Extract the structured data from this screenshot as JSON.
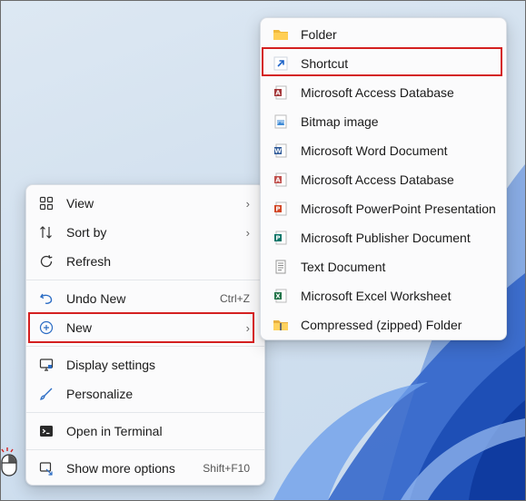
{
  "context_menu": {
    "items": [
      {
        "label": "View",
        "icon": "grid-icon",
        "has_submenu": true
      },
      {
        "label": "Sort by",
        "icon": "sort-icon",
        "has_submenu": true
      },
      {
        "label": "Refresh",
        "icon": "refresh-icon"
      },
      {
        "label": "Undo New",
        "icon": "undo-icon",
        "shortcut": "Ctrl+Z"
      },
      {
        "label": "New",
        "icon": "plus-circle-icon",
        "has_submenu": true,
        "highlighted": true
      },
      {
        "label": "Display settings",
        "icon": "display-icon"
      },
      {
        "label": "Personalize",
        "icon": "brush-icon"
      },
      {
        "label": "Open in Terminal",
        "icon": "terminal-icon"
      },
      {
        "label": "Show more options",
        "icon": "more-options-icon",
        "shortcut": "Shift+F10"
      }
    ]
  },
  "new_submenu": {
    "items": [
      {
        "label": "Folder",
        "icon": "folder-icon"
      },
      {
        "label": "Shortcut",
        "icon": "shortcut-icon",
        "highlighted": true
      },
      {
        "label": "Microsoft Access Database",
        "icon": "access-icon"
      },
      {
        "label": "Bitmap image",
        "icon": "bitmap-icon"
      },
      {
        "label": "Microsoft Word Document",
        "icon": "word-icon"
      },
      {
        "label": "Microsoft Access Database",
        "icon": "access-icon"
      },
      {
        "label": "Microsoft PowerPoint Presentation",
        "icon": "powerpoint-icon"
      },
      {
        "label": "Microsoft Publisher Document",
        "icon": "publisher-icon"
      },
      {
        "label": "Text Document",
        "icon": "text-document-icon"
      },
      {
        "label": "Microsoft Excel Worksheet",
        "icon": "excel-icon"
      },
      {
        "label": "Compressed (zipped) Folder",
        "icon": "zip-folder-icon"
      }
    ]
  },
  "colors": {
    "highlight_border": "#d42020",
    "accent": "#0067c0"
  }
}
